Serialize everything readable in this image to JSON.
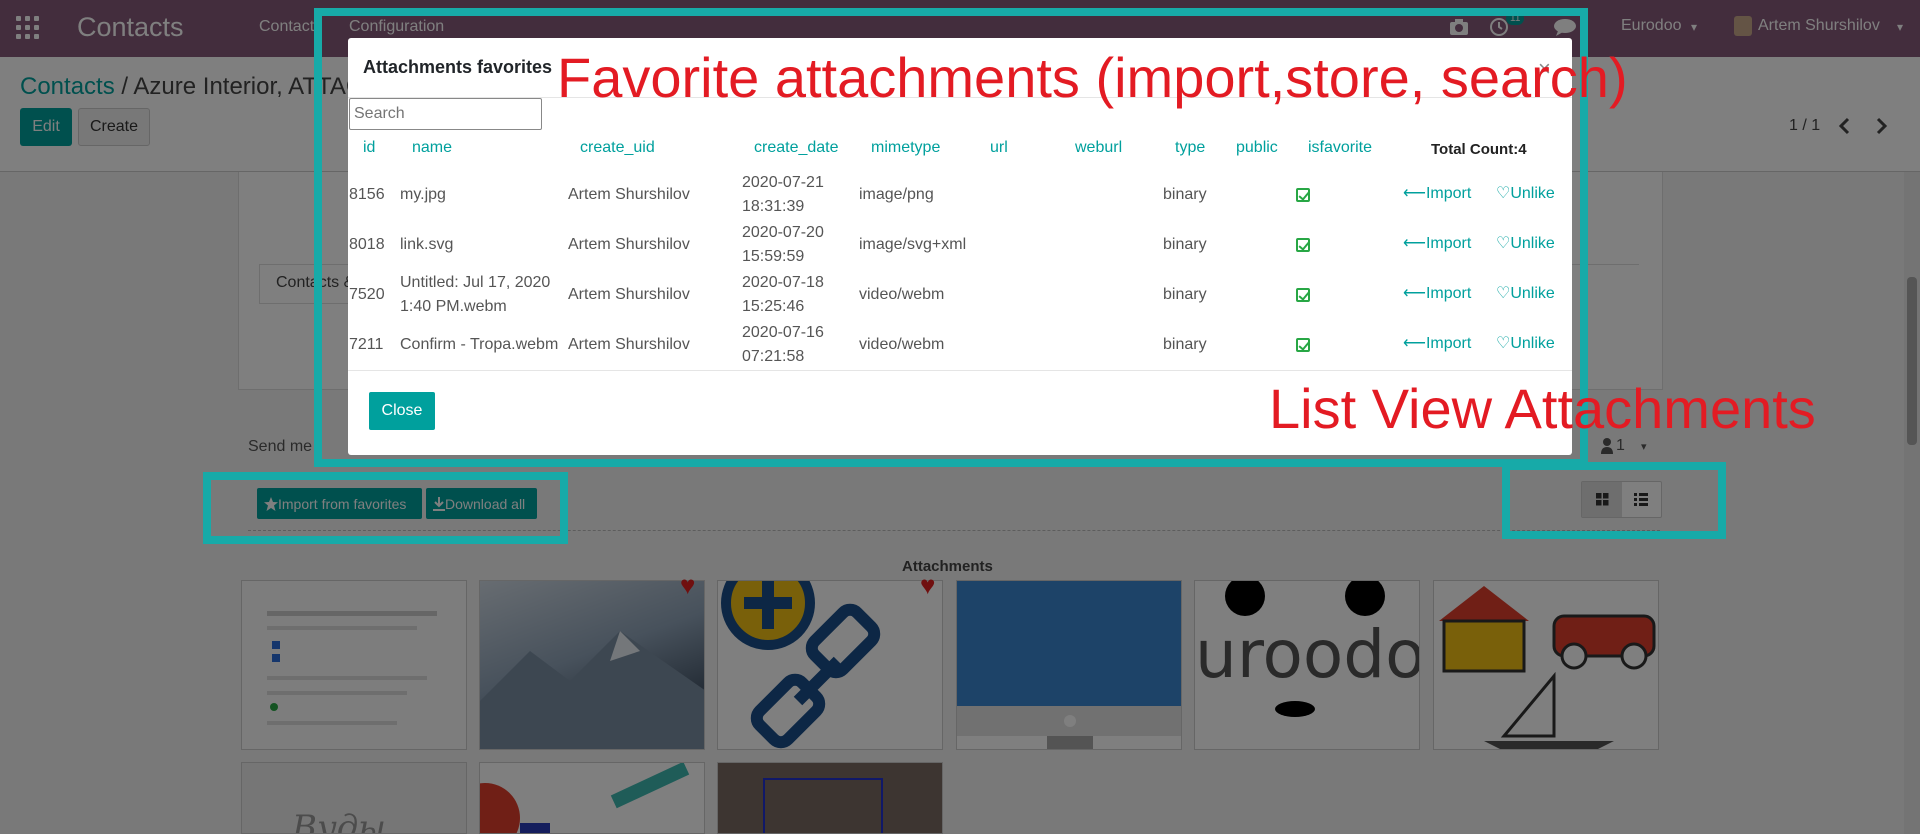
{
  "navbar": {
    "brand": "Contacts",
    "menu": [
      "Contacts",
      "Configuration"
    ],
    "activity_count": "11",
    "company": "Eurodoo",
    "user": "Artem Shurshilov",
    "dropdown_caret": "▾"
  },
  "control_panel": {
    "breadcrumb_root": "Contacts",
    "breadcrumb_separator": "/",
    "breadcrumb_current": "Azure Interior, ATTACH",
    "edit_label": "Edit",
    "create_label": "Create",
    "pager": "1 / 1"
  },
  "sheet": {
    "tab_partial": "Contacts &"
  },
  "chatter": {
    "send_message_partial": "Send me",
    "followers_count": "1",
    "import_from_favorites": "Import from favorites",
    "download_all": "Download all",
    "attachments_title": "Attachments",
    "thumb_text_vudu": "Вуды",
    "thumb_text_eurodoo": "uroodo"
  },
  "modal": {
    "title": "Attachments favorites",
    "close_x": "×",
    "search_placeholder": "Search",
    "columns": [
      "id",
      "name",
      "create_uid",
      "create_date",
      "mimetype",
      "url",
      "weburl",
      "type",
      "public",
      "isfavorite"
    ],
    "total_count": "Total Count:4",
    "rows": [
      {
        "id": "8156",
        "name": "my.jpg",
        "create_uid": "Artem Shurshilov",
        "date": "2020-07-21",
        "time": "18:31:39",
        "mimetype": "image/png",
        "type": "binary",
        "import": "⟵Import",
        "unlike": "♡Unlike"
      },
      {
        "id": "8018",
        "name": "link.svg",
        "create_uid": "Artem Shurshilov",
        "date": "2020-07-20",
        "time": "15:59:59",
        "mimetype": "image/svg+xml",
        "type": "binary",
        "import": "⟵Import",
        "unlike": "♡Unlike"
      },
      {
        "id": "7520",
        "name": "Untitled: Jul 17, 2020",
        "name2": "1:40 PM.webm",
        "create_uid": "Artem Shurshilov",
        "date": "2020-07-18",
        "time": "15:25:46",
        "mimetype": "video/webm",
        "type": "binary",
        "import": "⟵Import",
        "unlike": "♡Unlike"
      },
      {
        "id": "7211",
        "name": "Confirm - Tropa.webm",
        "create_uid": "Artem Shurshilov",
        "date": "2020-07-16",
        "time": "07:21:58",
        "mimetype": "video/webm",
        "type": "binary",
        "import": "⟵Import",
        "unlike": "♡Unlike"
      }
    ],
    "close_button": "Close"
  },
  "annotations": {
    "favorites": "Favorite attachments (import,store, search)",
    "list_view": "List View Attachments",
    "color": "#e31b23",
    "box_color": "#17aaa8"
  },
  "colors": {
    "navbar": "#875a7b",
    "primary": "#00a09d",
    "heart": "#e01e1e"
  }
}
